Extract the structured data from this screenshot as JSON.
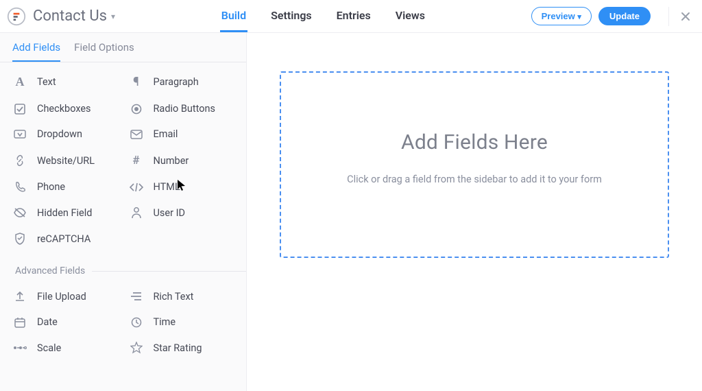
{
  "header": {
    "form_title": "Contact Us",
    "tabs": {
      "build": "Build",
      "settings": "Settings",
      "entries": "Entries",
      "views": "Views"
    },
    "preview_label": "Preview",
    "update_label": "Update"
  },
  "sidebar": {
    "tabs": {
      "add_fields": "Add Fields",
      "field_options": "Field Options"
    },
    "basic_fields": {
      "text": "Text",
      "paragraph": "Paragraph",
      "checkboxes": "Checkboxes",
      "radio": "Radio Buttons",
      "dropdown": "Dropdown",
      "email": "Email",
      "url": "Website/URL",
      "number": "Number",
      "phone": "Phone",
      "html": "HTML",
      "hidden": "Hidden Field",
      "userid": "User ID",
      "recaptcha": "reCAPTCHA"
    },
    "advanced_label": "Advanced Fields",
    "advanced_fields": {
      "file": "File Upload",
      "richtext": "Rich Text",
      "date": "Date",
      "time": "Time",
      "scale": "Scale",
      "star": "Star Rating"
    }
  },
  "canvas": {
    "headline": "Add Fields Here",
    "hint": "Click or drag a field from the sidebar to add it to your form"
  },
  "colors": {
    "accent": "#2f8ff5"
  }
}
